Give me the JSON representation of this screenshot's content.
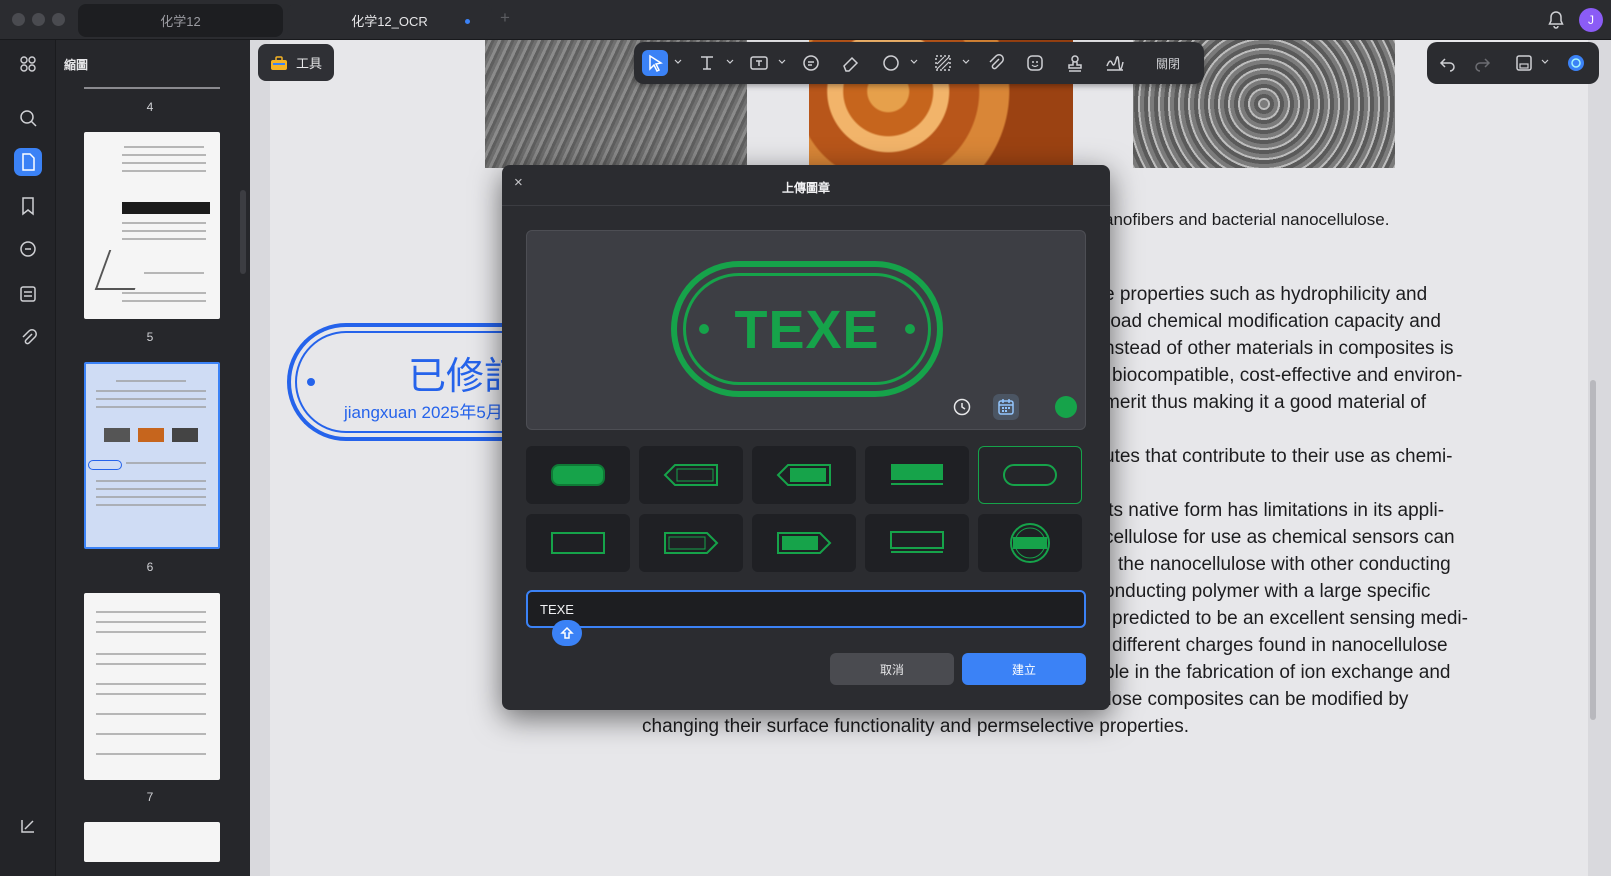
{
  "window": {
    "tabs": [
      {
        "label": "化学12",
        "active": false
      },
      {
        "label": "化学12_OCR",
        "active": true,
        "unsaved_dot": true
      }
    ],
    "new_tab_label": "+",
    "avatar_initial": "J",
    "accent_color": "#3b82f6"
  },
  "sidebar": {
    "panel_title": "縮圖",
    "rail_icons": [
      "grid-icon",
      "search-icon",
      "pages-icon",
      "bookmark-icon",
      "comment-icon",
      "form-icon",
      "attachment-icon"
    ],
    "selected_rail_icon": "pages-icon",
    "thumbnails": [
      {
        "page": "4"
      },
      {
        "page": "5"
      },
      {
        "page": "6",
        "selected": true
      },
      {
        "page": "7"
      }
    ]
  },
  "toolbar": {
    "tools_label": "工具",
    "close_label": "關閉",
    "selected_tool": "select-tool"
  },
  "document": {
    "caption_tail": "anofibers and bacterial nanocellulose.",
    "lines": [
      "e  properties  such  as  hydrophilicity  and",
      "road  chemical  modification  capacity  and",
      "nstead  of  other  materials  in  composites  is",
      "biocompatible,  cost-effective  and  environ-",
      "merit  thus  making  it  a  good  material  of",
      "utes  that  contribute  to  their  use  as  chemi-",
      "its  native  form  has  limitations  in  its  appli-",
      "cellulose  for  use  as  chemical  sensors  can",
      "the  nanocellulose  with  other  conducting",
      "onducting  polymer  with  a  large  specific",
      "predicted  to  be  an  excellent  sensing  medi-",
      "different  charges  found  in  nanocellulose",
      "ble  in  the  fabrication  of  ion  exchange  and",
      "permselective  membranes.  These  developed  nanocellulose  composites  can  be  modified  by",
      "changing their surface functionality and permselective properties."
    ],
    "placed_stamp": {
      "title": "已修訂",
      "subtitle": "jiangxuan 2025年5月",
      "color": "#2563eb"
    }
  },
  "dialog": {
    "title": "上傳圖章",
    "close_label": "×",
    "preview_text": "TEXE",
    "stamp_color": "#16a34a",
    "text_value": "TEXE",
    "cancel_label": "取消",
    "create_label": "建立",
    "selected_style_index": 4,
    "styles": [
      "filled-rounded",
      "arrow-left-outline",
      "arrow-left-filled",
      "filled-banner",
      "pill-outline",
      "rect-outline",
      "arrow-right-outline",
      "arrow-right-filled",
      "underline-box",
      "circle-band"
    ]
  }
}
